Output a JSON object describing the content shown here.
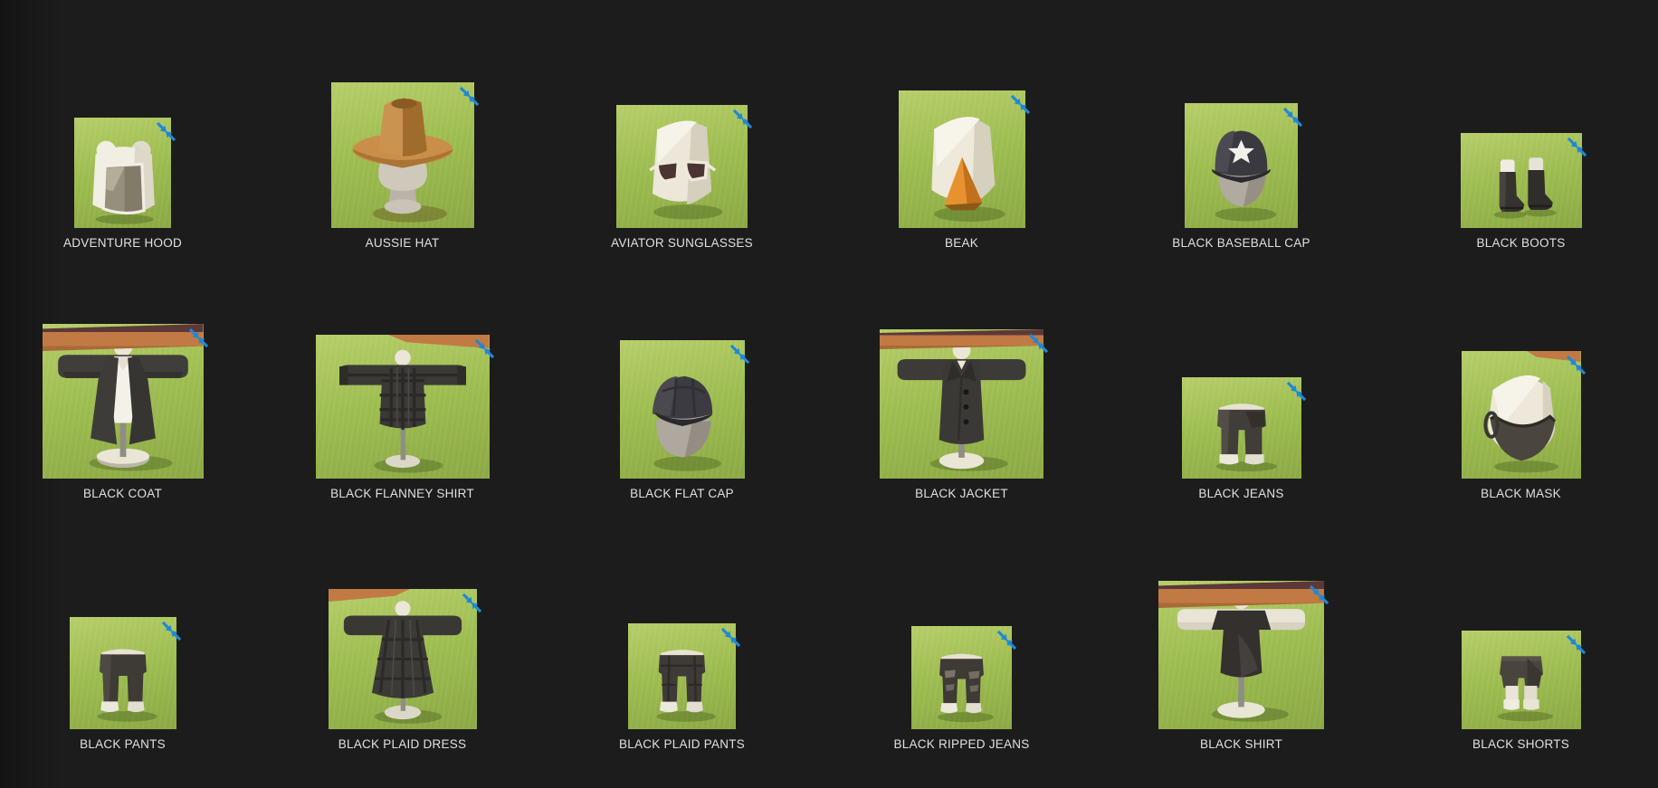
{
  "window": {
    "background": "#1c1c1c"
  },
  "colors": {
    "grass_light": "#b6cd68",
    "grass_mid": "#9cbc4f",
    "grass_dark": "#8ba843",
    "dirt_orange": "#c27a44",
    "track_maroon": "#5d3838",
    "icon_blue": "#1f88d6",
    "label_text": "#e0e0e0"
  },
  "icons": {
    "thumbnail_corner": "collapse-arrows-icon"
  },
  "gallery": {
    "items": [
      {
        "label": "ADVENTURE HOOD",
        "art": "adventure-hood"
      },
      {
        "label": "AUSSIE HAT",
        "art": "aussie-hat"
      },
      {
        "label": "AVIATOR SUNGLASSES",
        "art": "aviator-sunglasses"
      },
      {
        "label": "BEAK",
        "art": "beak"
      },
      {
        "label": "BLACK BASEBALL CAP",
        "art": "black-baseball-cap"
      },
      {
        "label": "BLACK BOOTS",
        "art": "black-boots"
      },
      {
        "label": "BLACK COAT",
        "art": "black-coat"
      },
      {
        "label": "BLACK FLANNEY SHIRT",
        "art": "black-flanney-shirt"
      },
      {
        "label": "BLACK FLAT CAP",
        "art": "black-flat-cap"
      },
      {
        "label": "BLACK JACKET",
        "art": "black-jacket"
      },
      {
        "label": "BLACK JEANS",
        "art": "black-jeans"
      },
      {
        "label": "BLACK MASK",
        "art": "black-mask"
      },
      {
        "label": "BLACK PANTS",
        "art": "black-pants"
      },
      {
        "label": "BLACK PLAID DRESS",
        "art": "black-plaid-dress"
      },
      {
        "label": "BLACK PLAID PANTS",
        "art": "black-plaid-pants"
      },
      {
        "label": "BLACK RIPPED JEANS",
        "art": "black-ripped-jeans"
      },
      {
        "label": "BLACK SHIRT",
        "art": "black-shirt"
      },
      {
        "label": "BLACK SHORTS",
        "art": "black-shorts"
      }
    ]
  }
}
